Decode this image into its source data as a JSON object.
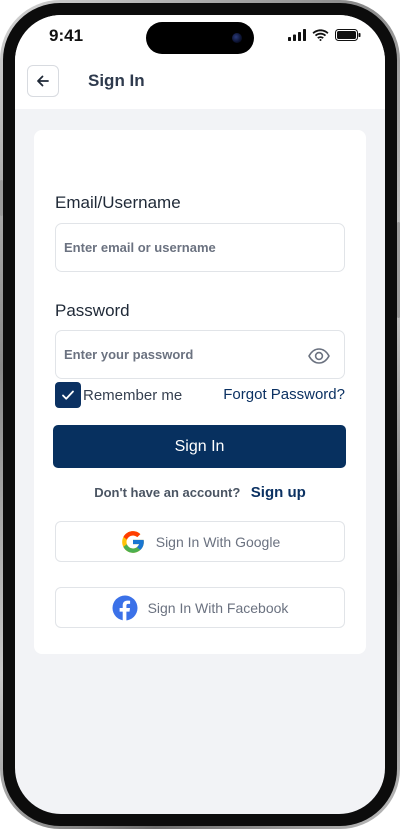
{
  "status_bar": {
    "time": "9:41",
    "icons": [
      "cellular-signal-icon",
      "wifi-icon",
      "battery-icon"
    ]
  },
  "header": {
    "back_icon": "arrow-left-icon",
    "title": "Sign In"
  },
  "form": {
    "email_label": "Email/Username",
    "email_placeholder": "Enter email or username",
    "email_value": "",
    "password_label": "Password",
    "password_placeholder": "Enter your password",
    "password_value": "",
    "password_toggle_icon": "eye-icon",
    "remember_label": "Remember me",
    "remember_checked": true,
    "forgot_link": "Forgot Password?",
    "submit_label": "Sign In"
  },
  "signup": {
    "prompt": "Don't have an account?",
    "link": "Sign up"
  },
  "social": {
    "google_label": "Sign In With Google",
    "google_icon": "google-icon",
    "facebook_label": "Sign In With Facebook",
    "facebook_icon": "facebook-icon"
  },
  "colors": {
    "primary": "#07305f",
    "background": "#f2f3f6",
    "card": "#ffffff",
    "facebook_blue": "#3b71e8"
  }
}
